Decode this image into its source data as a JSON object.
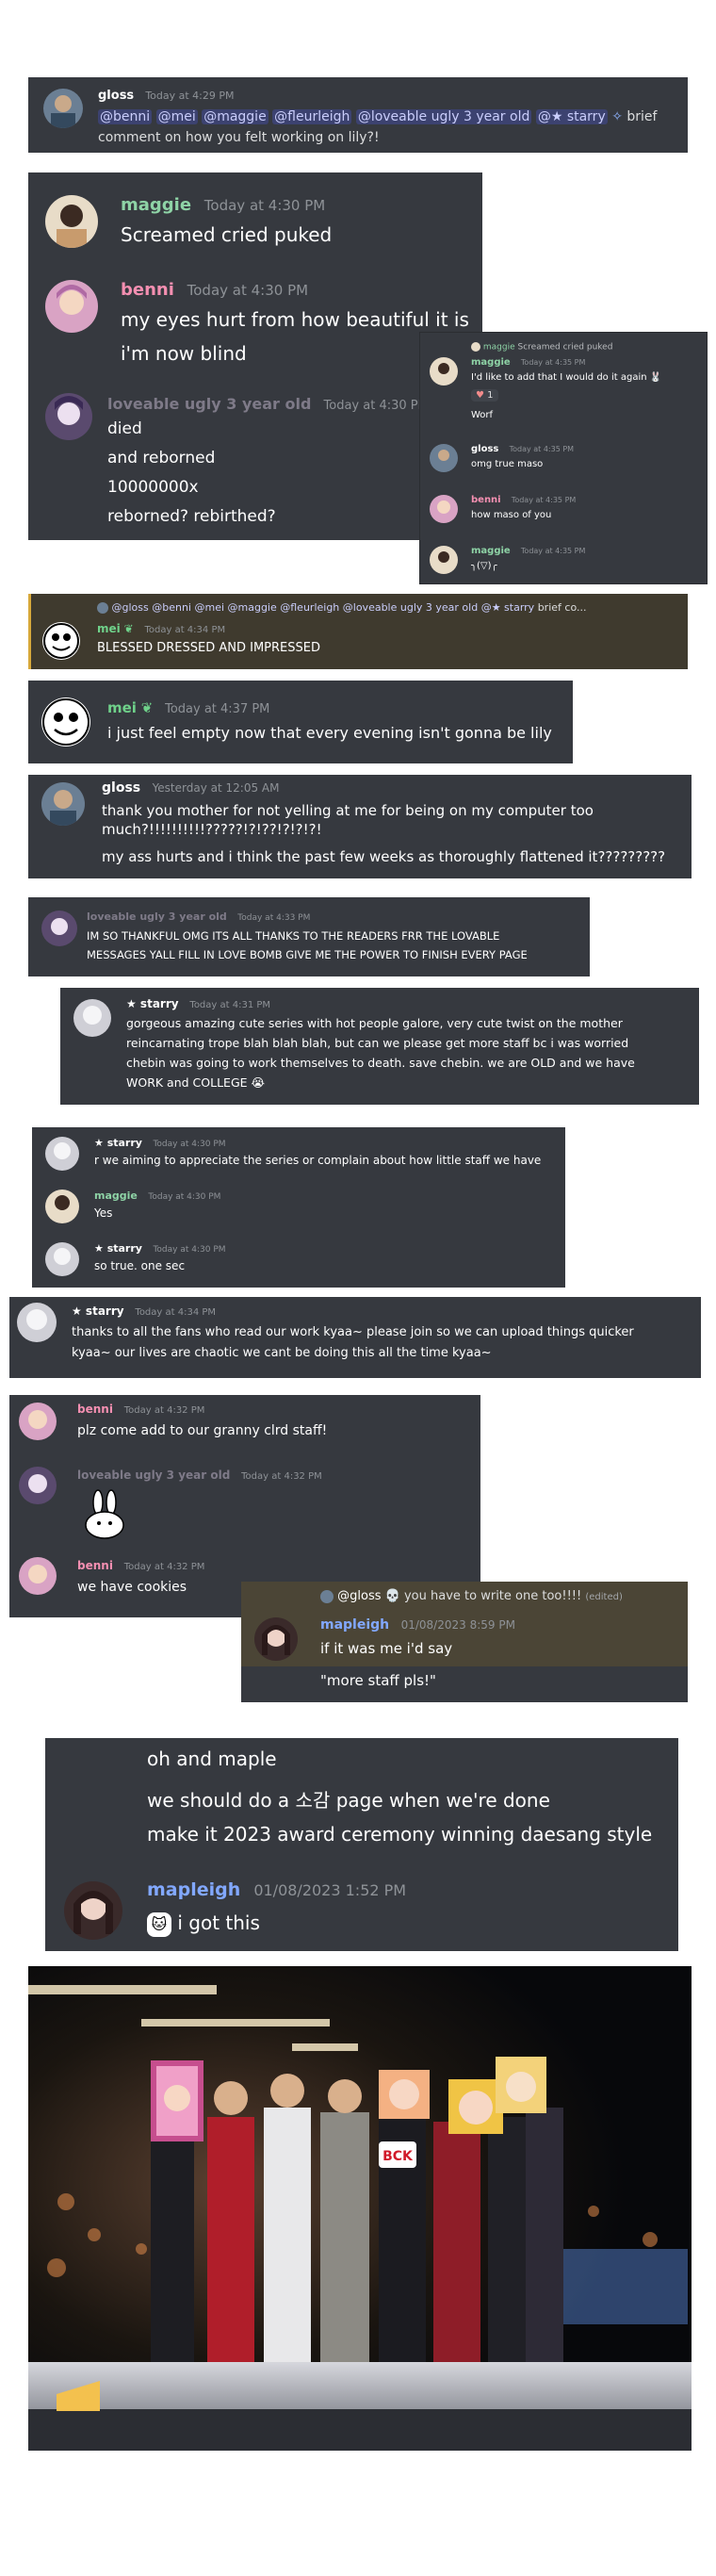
{
  "colors": {
    "bg": "#36393f",
    "text": "#dcddde",
    "timestamp": "#8e9297",
    "gloss": "#ffffff",
    "maggie": "#8ed3a6",
    "benni": "#f48fb1",
    "loveable": "#7e7a88",
    "mei": "#6fd18a",
    "starry": "#ffffff",
    "mapleigh": "#82a8ff"
  },
  "c1": {
    "name": "gloss",
    "time": "Today at 4:29 PM",
    "mentions": [
      "@benni",
      "@mei",
      "@maggie",
      "@fleurleigh",
      "@loveable ugly 3 year old",
      "@★ starry"
    ],
    "text_tail": "brief",
    "line2": "comment on how you felt working on lily?!"
  },
  "c2": {
    "m1": {
      "name": "maggie",
      "time": "Today at 4:30 PM",
      "text": "Screamed cried puked"
    },
    "m2": {
      "name": "benni",
      "time": "Today at 4:30 PM",
      "line1": "my eyes hurt from how beautiful it is",
      "line2": "i'm now blind"
    },
    "m3": {
      "name": "loveable ugly 3 year old",
      "time": "Today at 4:30 PM",
      "lines": [
        "died",
        "and reborned",
        "10000000x",
        "reborned? rebirthed?"
      ]
    }
  },
  "c3": {
    "reply_name": "maggie",
    "reply_text": "Screamed cried puked",
    "m1": {
      "name": "maggie",
      "time": "Today at 4:35 PM",
      "text": "I'd like to add that I would do it again",
      "reaction": "1",
      "text2": "Worf"
    },
    "m2": {
      "name": "gloss",
      "time": "Today at 4:35 PM",
      "text": "omg true maso"
    },
    "m3": {
      "name": "benni",
      "time": "Today at 4:35 PM",
      "text": "how maso of you"
    },
    "m4": {
      "name": "maggie",
      "time": "Today at 4:35 PM",
      "text": "╮(▽)╭"
    }
  },
  "c4": {
    "reply": "@gloss @benni @mei @maggie @fleurleigh @loveable ugly 3 year old @★ starry",
    "reply_tail": "brief co...",
    "name": "mei",
    "time": "Today at 4:34 PM",
    "text": "BLESSED DRESSED AND IMPRESSED"
  },
  "c5": {
    "name": "mei",
    "time": "Today at 4:37 PM",
    "text": "i just feel empty now that every evening isn't gonna be lily"
  },
  "c6": {
    "name": "gloss",
    "time": "Yesterday at 12:05 AM",
    "text1": "thank you mother for not yelling at me for being on my computer too much?!!!!!!!!!!?????!?!??!?!?!?!",
    "text2": "my ass hurts and i think the past few weeks as thoroughly flattened it?????????"
  },
  "c7": {
    "name": "loveable ugly 3 year old",
    "time": "Today at 4:33 PM",
    "line1": "IM SO THANKFUL OMG ITS ALL THANKS TO THE READERS FRR THE LOVABLE",
    "line2": "MESSAGES YALL FILL IN LOVE BOMB GIVE ME THE POWER TO FINISH EVERY PAGE"
  },
  "c8": {
    "name": "★ starry",
    "time": "Today at 4:31 PM",
    "lines": [
      "gorgeous amazing cute series with hot people galore, very cute twist on the mother",
      "reincarnating trope blah blah blah, but can we please get more staff bc i was worried",
      "chebin was going to work themselves to death. save chebin. we are OLD and we have",
      "WORK and COLLEGE"
    ]
  },
  "c9": {
    "m1": {
      "name": "★ starry",
      "time": "Today at 4:30 PM",
      "text": "r we aiming to appreciate the series or complain about how little staff we have"
    },
    "m2": {
      "name": "maggie",
      "time": "Today at 4:30 PM",
      "text": "Yes"
    },
    "m3": {
      "name": "★ starry",
      "time": "Today at 4:30 PM",
      "text": "so true. one sec"
    }
  },
  "c10": {
    "name": "★ starry",
    "time": "Today at 4:34 PM",
    "line1": "thanks to all the fans who read our work kyaa~ please join so we can upload things quicker",
    "line2": "kyaa~ our lives are chaotic we cant be doing this all the time kyaa~"
  },
  "c11": {
    "m1": {
      "name": "benni",
      "time": "Today at 4:32 PM",
      "text": "plz come add to our granny clrd staff!"
    },
    "m2": {
      "name": "loveable ugly 3 year old",
      "time": "Today at 4:32 PM"
    },
    "m3": {
      "name": "benni",
      "time": "Today at 4:32 PM",
      "text": "we have cookies"
    }
  },
  "c12": {
    "reply_name": "@gloss",
    "reply_text": "you have to write one too!!!!",
    "reply_edited": "(edited)",
    "name": "mapleigh",
    "time": "01/08/2023 8:59 PM",
    "line1": "if it was me i'd say",
    "line2": "\"more staff pls!\""
  },
  "c13": {
    "lines": [
      "oh and maple",
      "we should do a 소감 page when we're done",
      "make it 2023 award ceremony winning daesang style"
    ],
    "name": "mapleigh",
    "time": "01/08/2023 1:52 PM",
    "text": "i got this"
  },
  "photo": {
    "sign_text": "BCK"
  }
}
